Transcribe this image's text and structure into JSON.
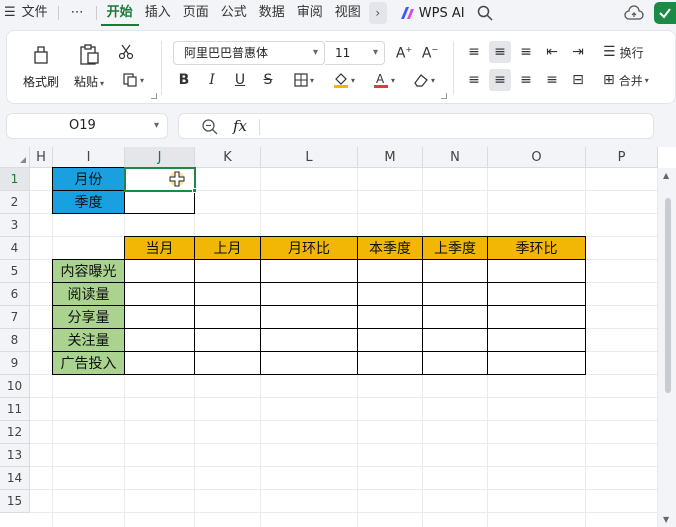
{
  "menubar": {
    "file_label": "文件",
    "more_label": "⋯",
    "tabs": [
      {
        "label": "开始",
        "active": true
      },
      {
        "label": "插入",
        "active": false
      },
      {
        "label": "页面",
        "active": false
      },
      {
        "label": "公式",
        "active": false
      },
      {
        "label": "数据",
        "active": false
      },
      {
        "label": "审阅",
        "active": false
      },
      {
        "label": "视图",
        "active": false
      }
    ],
    "wps_ai_label": "WPS AI"
  },
  "ribbon": {
    "format_painter_label": "格式刷",
    "paste_label": "粘贴",
    "font_name": "阿里巴巴普惠体",
    "font_size": "11",
    "wrap_label": "换行",
    "merge_label": "合并"
  },
  "formula_bar": {
    "name_box": "O19",
    "fx_label": "fx",
    "formula": ""
  },
  "columns": [
    "H",
    "I",
    "J",
    "K",
    "L",
    "M",
    "N",
    "O",
    "P"
  ],
  "selected_column": "J",
  "rows": [
    "1",
    "2",
    "3",
    "4",
    "5",
    "6",
    "7",
    "8",
    "9",
    "10",
    "11",
    "12",
    "13",
    "14",
    "15"
  ],
  "selected_row": "1",
  "cells": {
    "I1": "月份",
    "I2": "季度",
    "J4": "当月",
    "K4": "上月",
    "L4": "月环比",
    "M4": "本季度",
    "N4": "上季度",
    "O4": "季环比",
    "I5": "内容曝光",
    "I6": "阅读量",
    "I7": "分享量",
    "I8": "关注量",
    "I9": "广告投入"
  },
  "colors": {
    "accent": "#1a7a36",
    "header_blue": "#1aa0e0",
    "header_orange": "#f2b705",
    "row_green": "#a9d38f"
  }
}
